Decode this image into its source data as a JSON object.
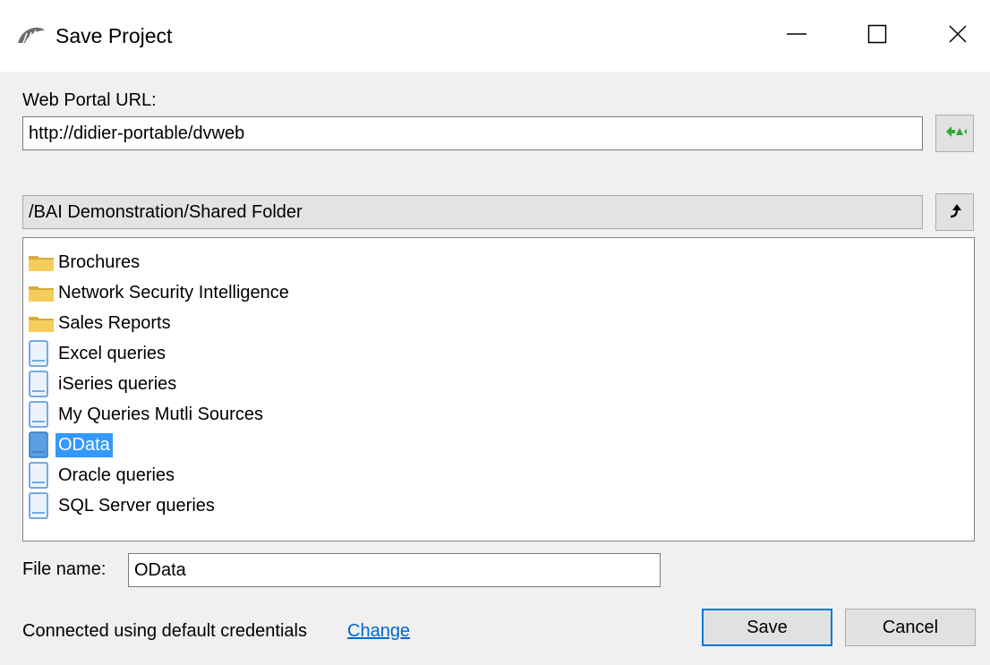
{
  "window": {
    "title": "Save Project",
    "app_icon": "wing-logo-icon",
    "minimize_icon": "minimize-icon",
    "maximize_icon": "maximize-icon",
    "close_icon": "close-icon"
  },
  "portal": {
    "label": "Web Portal URL:",
    "url": "http://didier-portable/dvweb",
    "connect_icon": "refresh-connect-icon"
  },
  "folder": {
    "path": "/BAI Demonstration/Shared Folder",
    "up_icon": "folder-up-icon"
  },
  "items": [
    {
      "label": "Brochures",
      "type": "folder"
    },
    {
      "label": "Network Security Intelligence",
      "type": "folder"
    },
    {
      "label": "Sales Reports",
      "type": "folder"
    },
    {
      "label": "Excel queries",
      "type": "document"
    },
    {
      "label": "iSeries queries",
      "type": "document"
    },
    {
      "label": "My Queries Mutli Sources",
      "type": "document"
    },
    {
      "label": "OData",
      "type": "document",
      "selected": true
    },
    {
      "label": "Oracle queries",
      "type": "document"
    },
    {
      "label": "SQL Server queries",
      "type": "document"
    }
  ],
  "file": {
    "label": "File name:",
    "value": "OData"
  },
  "status": {
    "text": "Connected using default credentials",
    "change_link": "Change"
  },
  "buttons": {
    "save": "Save",
    "cancel": "Cancel"
  },
  "colors": {
    "selection": "#3399ff",
    "link": "#0066cc",
    "default_button_border": "#0078d7",
    "folder_yellow": "#f5cd5a",
    "document_blue": "#4a90d9"
  }
}
